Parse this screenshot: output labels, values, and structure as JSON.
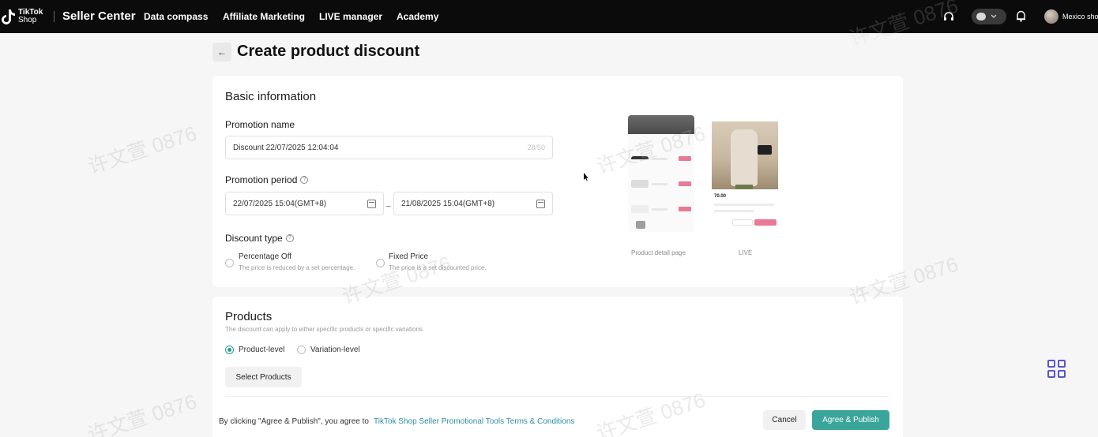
{
  "topbar": {
    "logo_line1": "TikTok",
    "logo_line2": "Shop",
    "brand": "Seller Center",
    "nav": [
      "Data compass",
      "Affiliate Marketing",
      "LIVE manager",
      "Academy"
    ],
    "shop_name": "Mexico shop",
    "icons": [
      "headset-icon",
      "chat-icon",
      "bell-icon"
    ]
  },
  "page": {
    "back": "←",
    "title": "Create product discount"
  },
  "basic": {
    "section_title": "Basic information",
    "promotion_name_label": "Promotion name",
    "promotion_name_value": "Discount 22/07/2025 12:04:04",
    "promotion_name_counter": "28/50",
    "period_label": "Promotion period",
    "start_date": "22/07/2025 15:04(GMT+8)",
    "end_date": "21/08/2025 15:04(GMT+8)",
    "range_separator": "–",
    "discount_type_label": "Discount type",
    "options": [
      {
        "title": "Percentage Off",
        "desc": "The price is reduced by a set percentage.",
        "selected": false
      },
      {
        "title": "Fixed Price",
        "desc": "The price is a set discounted price.",
        "selected": false
      }
    ],
    "preview_captions": [
      "Product detail page",
      "LIVE"
    ],
    "live_price": "70.00"
  },
  "products": {
    "section_title": "Products",
    "subtitle": "The discount can apply to either specific products or specific variations.",
    "levels": [
      {
        "label": "Product-level",
        "selected": true
      },
      {
        "label": "Variation-level",
        "selected": false
      }
    ],
    "select_button": "Select Products"
  },
  "footer": {
    "agreement_text": "By clicking \"Agree & Publish\", you agree to",
    "terms_link": "TikTok Shop Seller Promotional Tools Terms & Conditions",
    "cancel": "Cancel",
    "publish": "Agree & Publish"
  },
  "watermark": "许文萱 0876",
  "colors": {
    "accent": "#3aa59a",
    "link": "#2a8fa3",
    "tag": "#e87a95",
    "grid_icon": "#5a56c9"
  }
}
